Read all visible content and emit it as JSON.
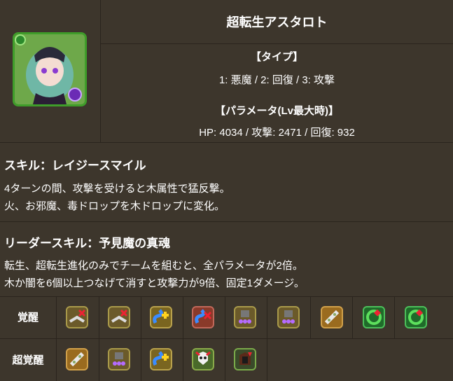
{
  "monster": {
    "name": "超転生アスタロト",
    "type_heading": "【タイプ】",
    "types": "1: 悪魔 / 2: 回復 / 3: 攻撃",
    "param_heading": "【パラメータ(Lv最大時)】",
    "params": "HP: 4034 / 攻撃: 2471 / 回復: 932"
  },
  "skill": {
    "heading": "スキル：レイジースマイル",
    "line1": "4ターンの間、攻撃を受けると木属性で猛反撃。",
    "line2": "火、お邪魔、毒ドロップを木ドロップに変化。"
  },
  "leader_skill": {
    "heading": "リーダースキル：予見魔の真魂",
    "line1": "転生、超転生進化のみでチームを組むと、全パラメータが2倍。",
    "line2": "木か闇を6個以上つなげて消すと攻撃力が9倍、固定1ダメージ。"
  },
  "awakenings": {
    "label": "覚醒",
    "icons": [
      "heal-bind-resist-icon",
      "heal-bind-resist-icon",
      "skill-boost-plus-icon",
      "skill-boost-minus-icon",
      "poison-drop-enhance-icon",
      "poison-drop-enhance-icon",
      "bind-resist-plus-icon",
      "wood-row-enhance-icon",
      "wood-row-enhance-icon"
    ]
  },
  "super_awakenings": {
    "label": "超覚醒",
    "icons": [
      "bind-resist-plus-icon",
      "poison-drop-enhance-icon",
      "skill-boost-plus-icon",
      "demon-killer-icon",
      "devil-killer-icon"
    ]
  }
}
